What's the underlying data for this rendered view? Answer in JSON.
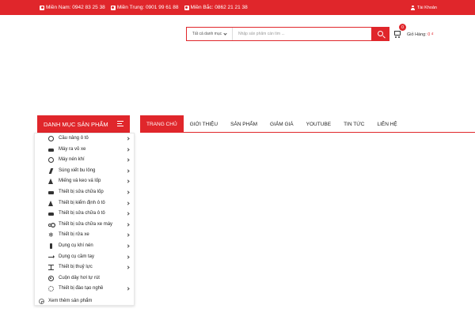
{
  "topbar": {
    "phones": [
      {
        "icon": "phone-icon",
        "text": "Miền Nam: 0942 83 25 38"
      },
      {
        "icon": "phone-icon",
        "text": "Miền Trung: 0901 99 61 88"
      },
      {
        "icon": "phone-icon",
        "text": "Miền Bắc: 0862 21 21 38"
      }
    ],
    "account_label": "Tài Khoản",
    "background": "#e0262b"
  },
  "search": {
    "category_label": "Tất cả danh mục",
    "placeholder": "Nhập sản phẩm cần tìm ...",
    "value": ""
  },
  "cart": {
    "count": "0",
    "label": "Giỏ Hàng:",
    "amount": "0 ₫"
  },
  "category_menu": {
    "title": "DANH MỤC SẢN PHẨM",
    "items": [
      {
        "label": "Cầu nâng ô tô",
        "icon": "lift-icon"
      },
      {
        "label": "Máy ra vỏ xe",
        "icon": "car-icon"
      },
      {
        "label": "Máy nén khí",
        "icon": "compressor-icon"
      },
      {
        "label": "Súng xiết bu lông",
        "icon": "bolt-icon"
      },
      {
        "label": "Miếng vá keo vá lốp",
        "icon": "flask-icon"
      },
      {
        "label": "Thiết bị sửa chữa lốp",
        "icon": "truck-icon"
      },
      {
        "label": "Thiết bị kiểm định ô tô",
        "icon": "warning-icon"
      },
      {
        "label": "Thiết bị sửa chữa ô tô",
        "icon": "car-front-icon"
      },
      {
        "label": "Thiết bị sửa chữa xe máy",
        "icon": "motorbike-icon"
      },
      {
        "label": "Thiết bị rửa xe",
        "icon": "snowflake-icon"
      },
      {
        "label": "Dụng cụ khí nén",
        "icon": "air-gun-icon"
      },
      {
        "label": "Dụng cụ cầm tay",
        "icon": "arrow-right-icon"
      },
      {
        "label": "Thiết bị thuỷ lực",
        "icon": "hourglass-icon"
      },
      {
        "label": "Cuộn dây hơi tự rút",
        "icon": "reel-icon"
      },
      {
        "label": "Thiết bị đào tạo nghề",
        "icon": "gears-icon"
      }
    ],
    "more_label": "Xem thêm sản phẩm"
  },
  "nav": {
    "items": [
      "TRANG CHỦ",
      "GIỚI THIỆU",
      "SẢN PHẨM",
      "GIẢM GIÁ",
      "YOUTUBE",
      "TIN TỨC",
      "LIÊN HỆ"
    ],
    "active_index": 0
  }
}
